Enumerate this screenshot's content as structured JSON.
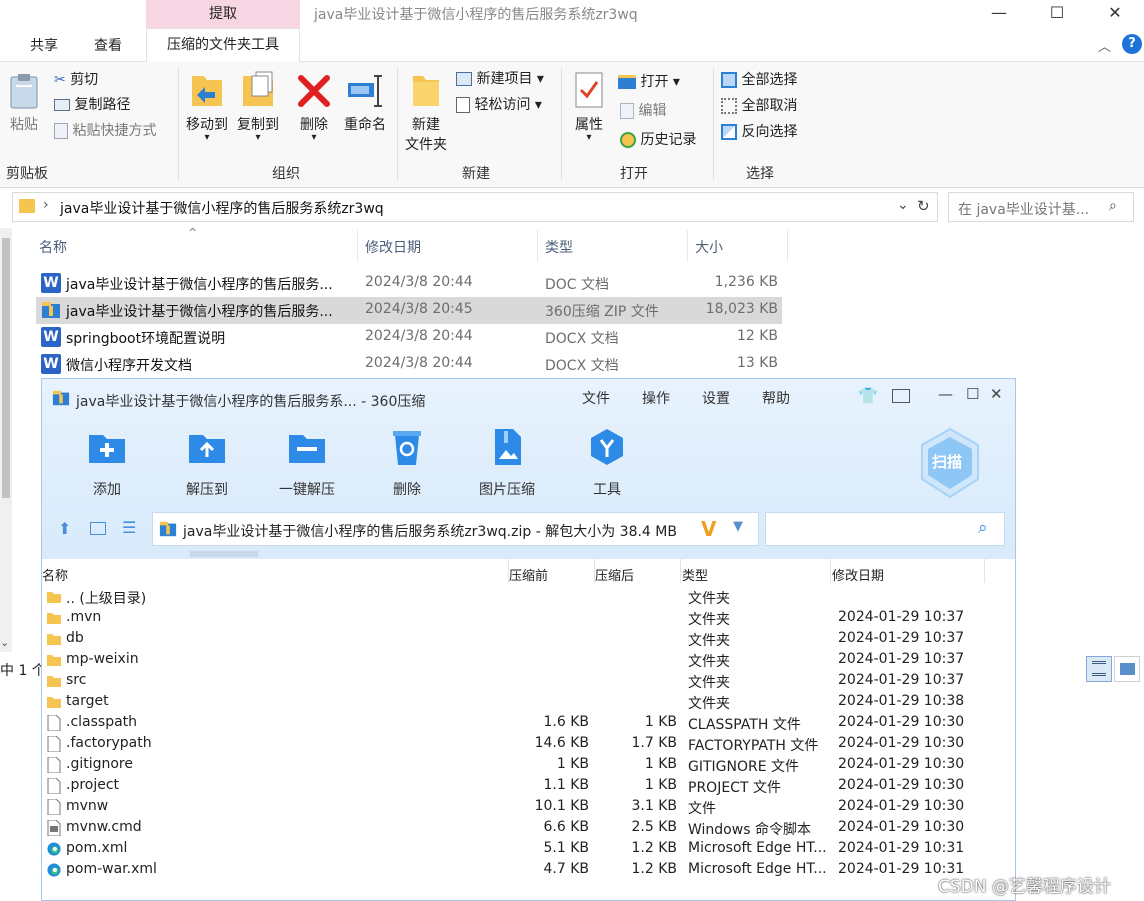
{
  "explorer": {
    "title": "java毕业设计基于微信小程序的售后服务系统zr3wq",
    "contextual_tab": "提取",
    "tabs": [
      "共享",
      "查看"
    ],
    "active_tab": "压缩的文件夹工具",
    "ribbon": {
      "clipboard": {
        "paste": "粘贴",
        "cut": "剪切",
        "copy_path": "复制路径",
        "paste_shortcut": "粘贴快捷方式",
        "group": "剪贴板"
      },
      "organize": {
        "move_to": "移动到",
        "copy_to": "复制到",
        "delete": "删除",
        "rename": "重命名",
        "group": "组织"
      },
      "new": {
        "new_folder_line1": "新建",
        "new_folder_line2": "文件夹",
        "new_item": "新建项目",
        "easy_access": "轻松访问",
        "group": "新建"
      },
      "open": {
        "properties": "属性",
        "open": "打开",
        "edit": "编辑",
        "history": "历史记录",
        "group": "打开"
      },
      "select": {
        "select_all": "全部选择",
        "select_none": "全部取消",
        "invert": "反向选择",
        "group": "选择"
      }
    },
    "address": "java毕业设计基于微信小程序的售后服务系统zr3wq",
    "search_placeholder": "在 java毕业设计基...",
    "columns": {
      "name": "名称",
      "date": "修改日期",
      "type": "类型",
      "size": "大小"
    },
    "files": [
      {
        "name": "java毕业设计基于微信小程序的售后服务...",
        "date": "2024/3/8 20:44",
        "type": "DOC 文档",
        "size": "1,236 KB",
        "icon": "word-icon"
      },
      {
        "name": "java毕业设计基于微信小程序的售后服务...",
        "date": "2024/3/8 20:45",
        "type": "360压缩 ZIP 文件",
        "size": "18,023 KB",
        "icon": "zip-icon"
      },
      {
        "name": "springboot环境配置说明",
        "date": "2024/3/8 20:44",
        "type": "DOCX 文档",
        "size": "12 KB",
        "icon": "word-icon"
      },
      {
        "name": "微信小程序开发文档",
        "date": "2024/3/8 20:44",
        "type": "DOCX 文档",
        "size": "13 KB",
        "icon": "word-icon"
      }
    ],
    "status": "中 1 个"
  },
  "zip": {
    "title": "java毕业设计基于微信小程序的售后服务系... - 360压缩",
    "menu": [
      "文件",
      "操作",
      "设置",
      "帮助"
    ],
    "tools": [
      "添加",
      "解压到",
      "一键解压",
      "删除",
      "图片压缩",
      "工具"
    ],
    "scan": "扫描",
    "path": "java毕业设计基于微信小程序的售后服务系统zr3wq.zip - 解包大小为 38.4 MB",
    "columns": {
      "name": "名称",
      "before": "压缩前",
      "after": "压缩后",
      "type": "类型",
      "date": "修改日期"
    },
    "rows": [
      {
        "name": ".. (上级目录)",
        "before": "",
        "after": "",
        "type": "文件夹",
        "date": "",
        "icon": "folder"
      },
      {
        "name": ".mvn",
        "before": "",
        "after": "",
        "type": "文件夹",
        "date": "2024-01-29 10:37",
        "icon": "folder"
      },
      {
        "name": "db",
        "before": "",
        "after": "",
        "type": "文件夹",
        "date": "2024-01-29 10:37",
        "icon": "folder"
      },
      {
        "name": "mp-weixin",
        "before": "",
        "after": "",
        "type": "文件夹",
        "date": "2024-01-29 10:37",
        "icon": "folder"
      },
      {
        "name": "src",
        "before": "",
        "after": "",
        "type": "文件夹",
        "date": "2024-01-29 10:37",
        "icon": "folder"
      },
      {
        "name": "target",
        "before": "",
        "after": "",
        "type": "文件夹",
        "date": "2024-01-29 10:38",
        "icon": "folder"
      },
      {
        "name": ".classpath",
        "before": "1.6 KB",
        "after": "1 KB",
        "type": "CLASSPATH 文件",
        "date": "2024-01-29 10:30",
        "icon": "file"
      },
      {
        "name": ".factorypath",
        "before": "14.6 KB",
        "after": "1.7 KB",
        "type": "FACTORYPATH 文件",
        "date": "2024-01-29 10:30",
        "icon": "file"
      },
      {
        "name": ".gitignore",
        "before": "1 KB",
        "after": "1 KB",
        "type": "GITIGNORE 文件",
        "date": "2024-01-29 10:30",
        "icon": "file"
      },
      {
        "name": ".project",
        "before": "1.1 KB",
        "after": "1 KB",
        "type": "PROJECT 文件",
        "date": "2024-01-29 10:30",
        "icon": "file"
      },
      {
        "name": "mvnw",
        "before": "10.1 KB",
        "after": "3.1 KB",
        "type": "文件",
        "date": "2024-01-29 10:30",
        "icon": "file"
      },
      {
        "name": "mvnw.cmd",
        "before": "6.6 KB",
        "after": "2.5 KB",
        "type": "Windows 命令脚本",
        "date": "2024-01-29 10:30",
        "icon": "cmd"
      },
      {
        "name": "pom.xml",
        "before": "5.1 KB",
        "after": "1.2 KB",
        "type": "Microsoft Edge HT...",
        "date": "2024-01-29 10:31",
        "icon": "edge"
      },
      {
        "name": "pom-war.xml",
        "before": "4.7 KB",
        "after": "1.2 KB",
        "type": "Microsoft Edge HT...",
        "date": "2024-01-29 10:31",
        "icon": "edge"
      }
    ]
  },
  "watermark": "CSDN @艺馨程序设计"
}
